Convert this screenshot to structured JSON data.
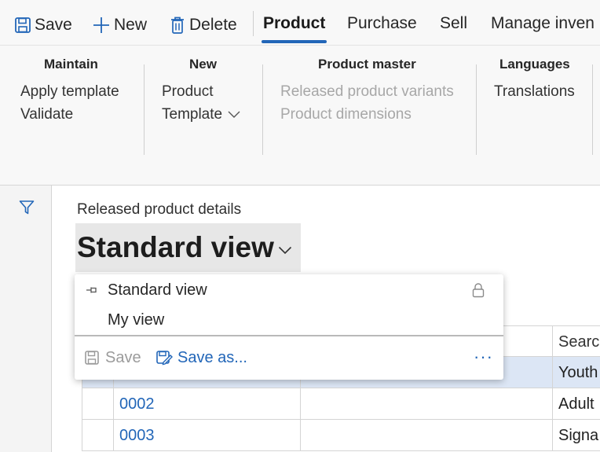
{
  "command_bar": {
    "save_label": "Save",
    "new_label": "New",
    "delete_label": "Delete",
    "tabs": [
      {
        "label": "Product",
        "active": true
      },
      {
        "label": "Purchase",
        "active": false
      },
      {
        "label": "Sell",
        "active": false
      },
      {
        "label": "Manage inven",
        "active": false
      }
    ]
  },
  "ribbon": {
    "groups": [
      {
        "title": "Maintain",
        "items": [
          {
            "label": "Apply template",
            "enabled": true
          },
          {
            "label": "Validate",
            "enabled": true
          }
        ]
      },
      {
        "title": "New",
        "items": [
          {
            "label": "Product",
            "enabled": true
          },
          {
            "label": "Template",
            "enabled": true,
            "has_dropdown": true
          }
        ]
      },
      {
        "title": "Product master",
        "items": [
          {
            "label": "Released product variants",
            "enabled": false
          },
          {
            "label": "Product dimensions",
            "enabled": false
          }
        ]
      },
      {
        "title": "Languages",
        "items": [
          {
            "label": "Translations",
            "enabled": true
          }
        ]
      }
    ]
  },
  "form": {
    "caption": "Released product details",
    "view_title": "Standard view"
  },
  "views_dropdown": {
    "items": [
      {
        "label": "Standard view",
        "pinned": true,
        "locked": true
      },
      {
        "label": "My view",
        "pinned": false,
        "locked": false
      }
    ],
    "save_label": "Save",
    "save_as_label": "Save as...",
    "more_label": "···"
  },
  "grid": {
    "columns": [
      "",
      "",
      "",
      "Search"
    ],
    "rows": [
      {
        "number": "",
        "search": "Youth",
        "selected": true
      },
      {
        "number": "0002",
        "search": "Adult",
        "selected": false
      },
      {
        "number": "0003",
        "search": "Signa",
        "selected": false
      }
    ]
  },
  "colors": {
    "accent": "#2266b8",
    "selected_row": "#dce6f5",
    "ribbon_bg": "#f8f8f8",
    "disabled_text": "#a7a7a7"
  },
  "icons": {
    "save": "floppy-disk-icon",
    "new": "plus-icon",
    "delete": "trash-icon",
    "filter": "funnel-icon",
    "pin": "pin-icon",
    "lock": "lock-icon",
    "save_as": "save-as-icon"
  }
}
